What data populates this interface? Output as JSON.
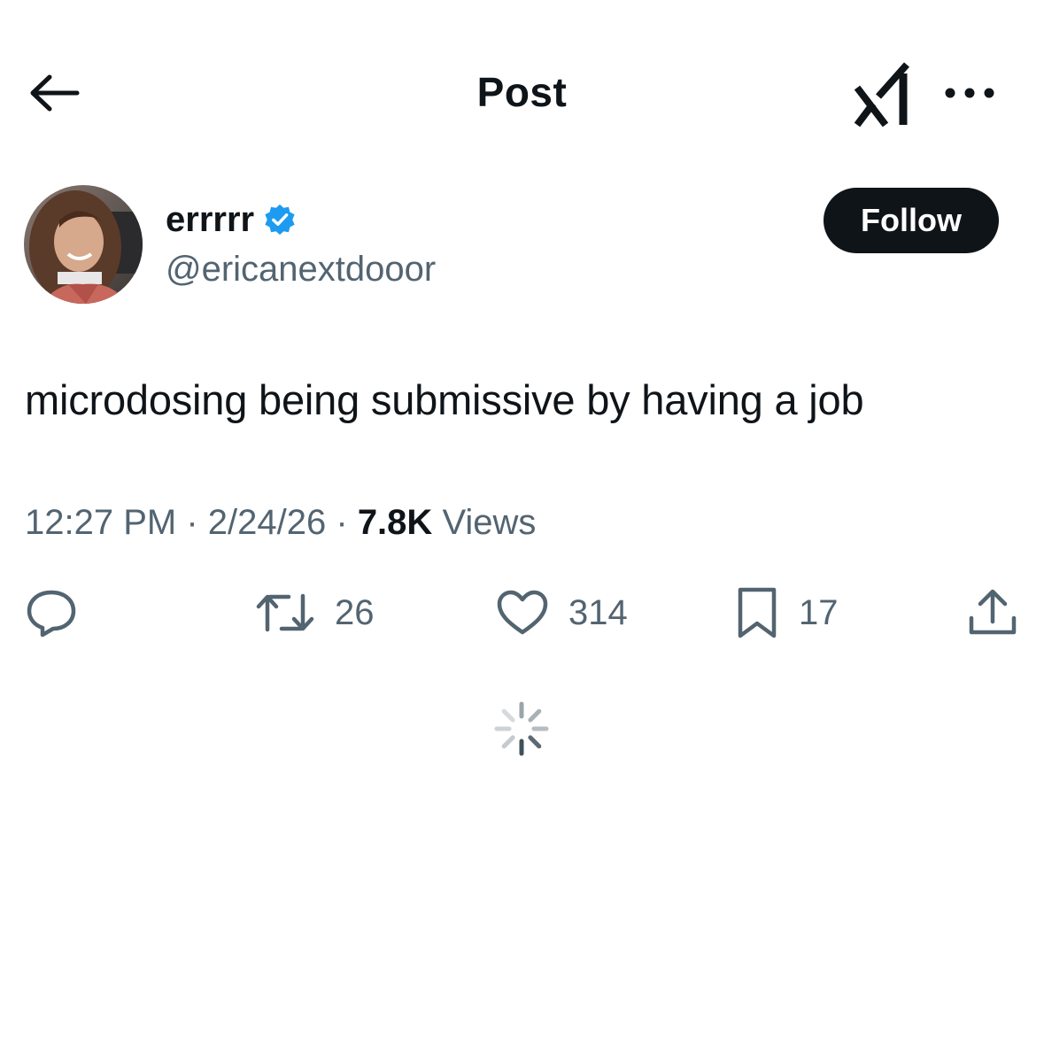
{
  "header": {
    "title": "Post",
    "back_icon": "arrow-left-icon",
    "grok_icon": "grok-logo-icon",
    "more_icon": "more-horizontal-icon"
  },
  "author": {
    "name": "errrrr",
    "handle": "@ericanextdooor",
    "verified": true,
    "verified_color": "#1d9bf0",
    "follow_label": "Follow"
  },
  "post": {
    "text": "microdosing being submissive by having a job",
    "time": "12:27 PM",
    "date": "2/24/26",
    "views_count": "7.8K",
    "views_label": "Views"
  },
  "actions": {
    "reply": {
      "icon": "reply-icon"
    },
    "repost": {
      "icon": "repost-icon",
      "count": "26"
    },
    "like": {
      "icon": "heart-icon",
      "count": "314"
    },
    "bookmark": {
      "icon": "bookmark-icon",
      "count": "17"
    },
    "share": {
      "icon": "share-icon"
    }
  },
  "colors": {
    "text_primary": "#0f1419",
    "text_secondary": "#536471",
    "follow_bg": "#0f1419",
    "verified": "#1d9bf0"
  }
}
